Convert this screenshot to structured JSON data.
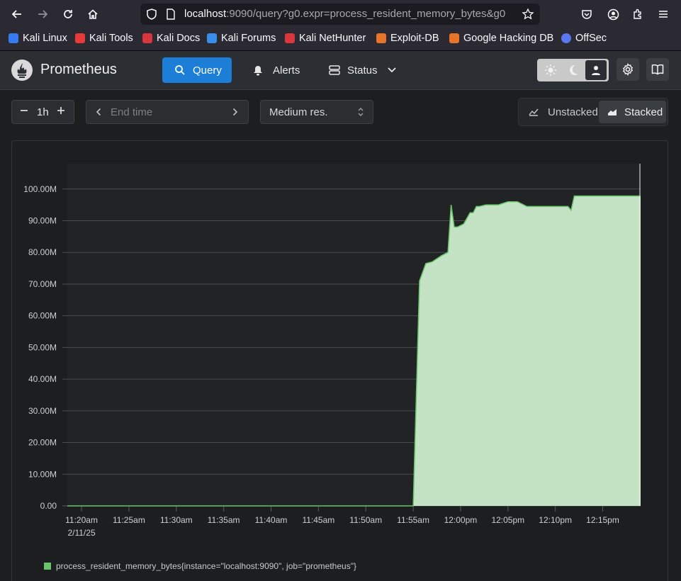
{
  "browser": {
    "url_host": "localhost",
    "url_rest": ":9090/query?g0.expr=process_resident_memory_bytes&g0"
  },
  "bookmarks": [
    {
      "label": "Kali Linux",
      "color": "#367bf0"
    },
    {
      "label": "Kali Tools",
      "color": "#e93a3a"
    },
    {
      "label": "Kali Docs",
      "color": "#d9363e"
    },
    {
      "label": "Kali Forums",
      "color": "#3a8de8"
    },
    {
      "label": "Kali NetHunter",
      "color": "#d9363e"
    },
    {
      "label": "Exploit-DB",
      "color": "#e8742a"
    },
    {
      "label": "Google Hacking DB",
      "color": "#e8742a"
    },
    {
      "label": "OffSec",
      "color": "#5a78f0"
    }
  ],
  "header": {
    "brand": "Prometheus",
    "nav": {
      "query": "Query",
      "alerts": "Alerts",
      "status": "Status"
    }
  },
  "controls": {
    "range_value": "1h",
    "end_time_placeholder": "End time",
    "resolution": "Medium res.",
    "unstacked": "Unstacked",
    "stacked": "Stacked",
    "stacked_selected": true
  },
  "chart_data": {
    "type": "area",
    "series": [
      {
        "name": "process_resident_memory_bytes{instance=\"localhost:9090\", job=\"prometheus\"}",
        "color": "#69c36a",
        "x": [
          "11:18:30",
          "11:55:00",
          "11:55:40",
          "11:56:20",
          "11:57:00",
          "11:58:00",
          "11:58:40",
          "11:59:00",
          "11:59:20",
          "11:59:40",
          "12:00:20",
          "12:01:00",
          "12:01:20",
          "12:01:40",
          "12:02:00",
          "12:02:40",
          "12:03:30",
          "12:04:00",
          "12:05:00",
          "12:05:20",
          "12:06:00",
          "12:07:00",
          "12:07:20",
          "12:08:00",
          "12:11:20",
          "12:11:40",
          "12:12:00",
          "12:12:20",
          "12:19:00"
        ],
        "values": [
          0,
          0,
          71000000,
          76500000,
          77000000,
          79000000,
          80000000,
          95000000,
          88000000,
          88000000,
          89000000,
          92500000,
          92500000,
          94500000,
          94500000,
          95000000,
          95000000,
          95000000,
          96000000,
          96000000,
          96000000,
          94500000,
          94500000,
          94500000,
          94500000,
          93300000,
          97800000,
          97800000,
          97800000
        ]
      }
    ],
    "x_ticks": [
      "11:20am",
      "11:25am",
      "11:30am",
      "11:35am",
      "11:40am",
      "11:45am",
      "11:50am",
      "11:55am",
      "12:00pm",
      "12:05pm",
      "12:10pm",
      "12:15pm"
    ],
    "x_date_label": "2/11/25",
    "y_ticks": [
      "0.00",
      "10.00M",
      "20.00M",
      "30.00M",
      "40.00M",
      "50.00M",
      "60.00M",
      "70.00M",
      "80.00M",
      "90.00M",
      "100.00M"
    ],
    "xlim": [
      "11:18:30",
      "12:19:00"
    ],
    "ylim": [
      0,
      108000000
    ],
    "stacked": true,
    "grid": true,
    "legend_position": "bottom-left"
  }
}
